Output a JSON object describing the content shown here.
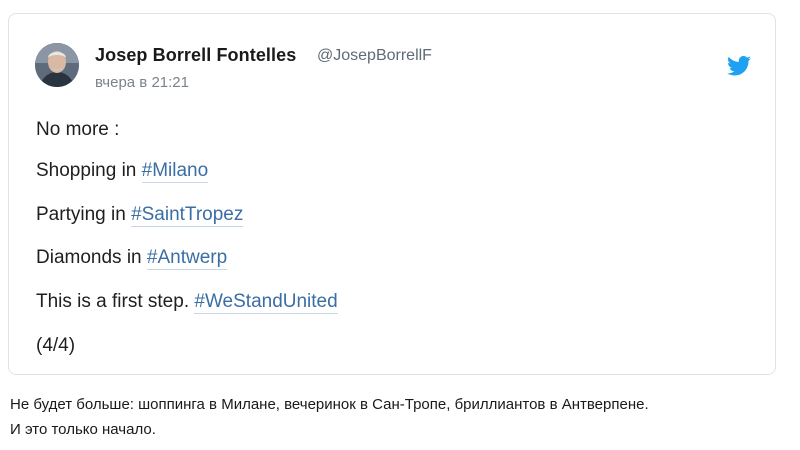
{
  "author": {
    "name": "Josep Borrell Fontelles",
    "handle": "@JosepBorrellF",
    "timestamp": "вчера в 21:21"
  },
  "icons": {
    "avatar": "author-photo",
    "platform": "twitter-bird-icon"
  },
  "colors": {
    "hashtag": "#3a6ea5",
    "twitter_blue": "#1da1f2"
  },
  "tweet": {
    "line1": "No more :",
    "line2_text": "Shopping in",
    "line2_tag": "#Milano",
    "line3_text": "Partying in",
    "line3_tag": "#SaintTropez",
    "line4_text": "Diamonds in",
    "line4_tag": "#Antwerp",
    "line5_text": "This is a first step.",
    "line5_tag": "#WeStandUnited",
    "line6": "(4/4)"
  },
  "caption": {
    "line1": "Не будет больше: шоппинга в Милане, вечеринок в Сан-Тропе, бриллиантов в Антверпене.",
    "line2": "И это только начало."
  }
}
